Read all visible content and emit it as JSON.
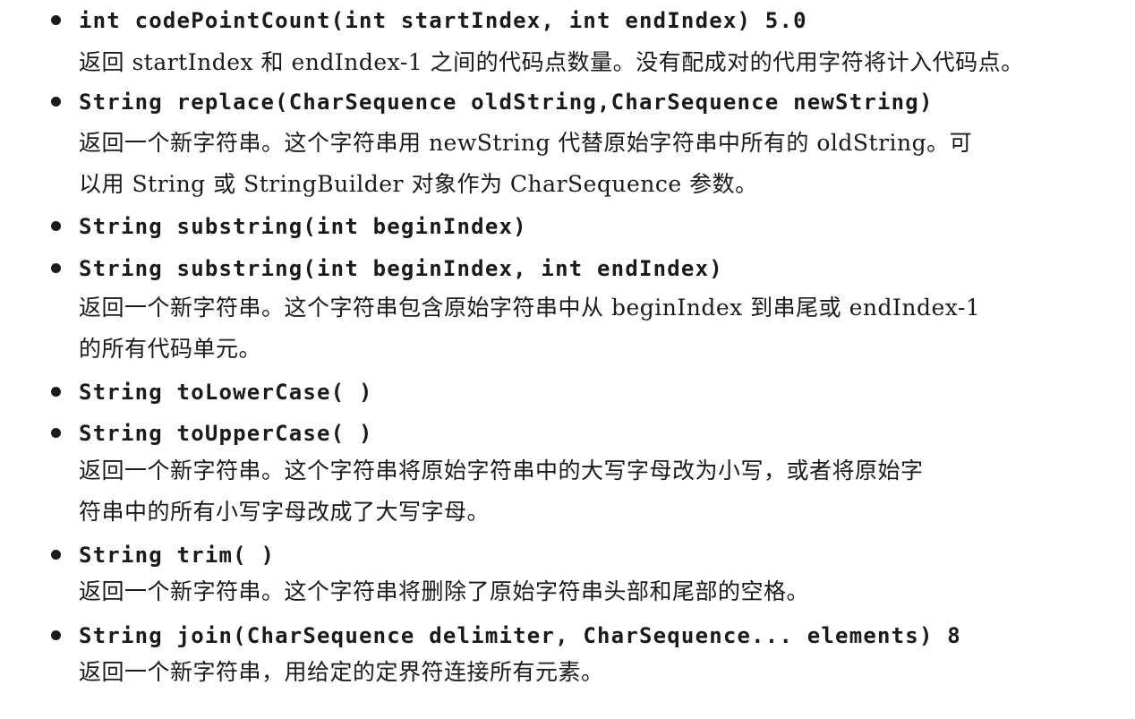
{
  "entries": [
    {
      "signature": "int codePointCount(int startIndex, int endIndex) 5.0",
      "description": [
        "返回 startIndex 和 endIndex-1 之间的代码点数量。没有配成对的代用字符将计入代码点。"
      ]
    },
    {
      "signature": "String replace(CharSequence oldString,CharSequence newString)",
      "description": [
        "返回一个新字符串。这个字符串用 newString 代替原始字符串中所有的 oldString。可",
        "以用 String 或 StringBuilder 对象作为 CharSequence 参数。"
      ]
    },
    {
      "signature": "String substring(int beginIndex)",
      "description": []
    },
    {
      "signature": "String substring(int beginIndex, int endIndex)",
      "description": [
        "返回一个新字符串。这个字符串包含原始字符串中从 beginIndex 到串尾或 endIndex-1",
        "的所有代码单元。"
      ]
    },
    {
      "signature": "String toLowerCase( )",
      "description": []
    },
    {
      "signature": "String toUpperCase( )",
      "description": [
        "返回一个新字符串。这个字符串将原始字符串中的大写字母改为小写，或者将原始字",
        "符串中的所有小写字母改成了大写字母。"
      ]
    },
    {
      "signature": "String trim( )",
      "description": [
        "返回一个新字符串。这个字符串将删除了原始字符串头部和尾部的空格。"
      ]
    },
    {
      "signature": "String join(CharSequence delimiter, CharSequence... elements) 8",
      "description": [
        "返回一个新字符串，用给定的定界符连接所有元素。"
      ]
    }
  ]
}
